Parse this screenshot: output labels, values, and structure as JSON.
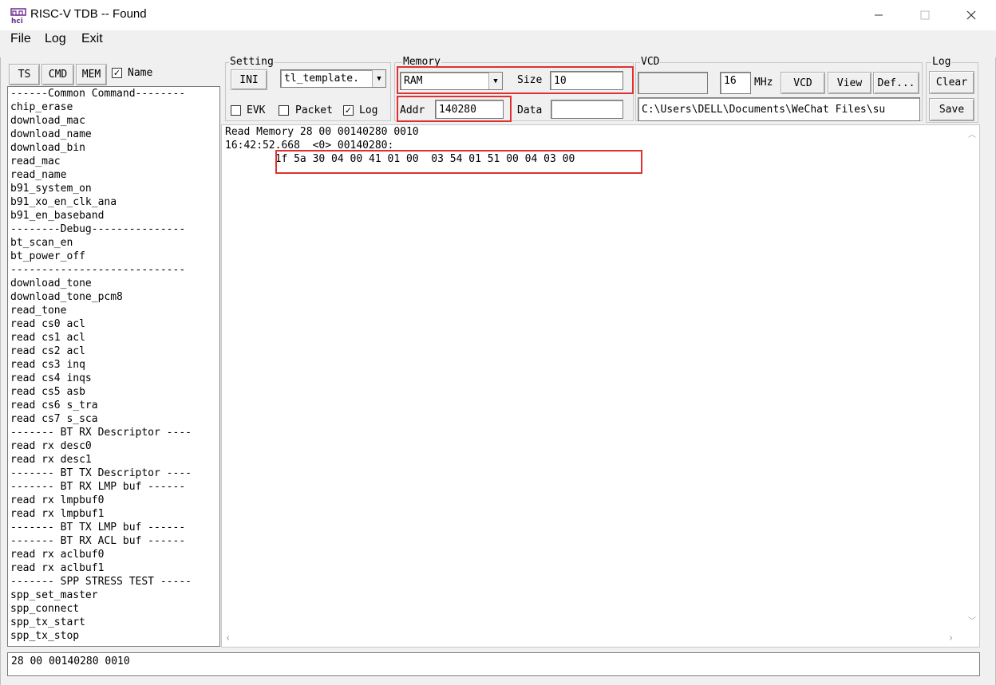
{
  "window": {
    "title": "RISC-V TDB -- Found",
    "app_icon_text": "hci",
    "minimize_icon": "minimize-icon",
    "maximize_icon": "maximize-icon",
    "close_icon": "close-icon"
  },
  "menu": {
    "items": [
      {
        "label": "File"
      },
      {
        "label": "Log"
      },
      {
        "label": "Exit"
      }
    ]
  },
  "left_tabs": {
    "ts": "TS",
    "cmd": "CMD",
    "mem": "MEM",
    "name_label": "Name",
    "name_checked": true
  },
  "commands": [
    "------Common Command--------",
    "chip_erase",
    "download_mac",
    "download_name",
    "download_bin",
    "read_mac",
    "read_name",
    "b91_system_on",
    "b91_xo_en_clk_ana",
    "b91_en_baseband",
    "--------Debug---------------",
    "bt_scan_en",
    "bt_power_off",
    "----------------------------",
    "download_tone",
    "download_tone_pcm8",
    "read_tone",
    "read cs0 acl",
    "read cs1 acl",
    "read cs2 acl",
    "read cs3 inq",
    "read cs4 inqs",
    "read cs5 asb",
    "read cs6 s_tra",
    "read cs7 s_sca",
    "------- BT RX Descriptor ----",
    "read rx desc0",
    "read rx desc1",
    "------- BT TX Descriptor ----",
    "------- BT RX LMP buf ------",
    "read rx lmpbuf0",
    "read rx lmpbuf1",
    "------- BT TX LMP buf ------",
    "------- BT RX ACL buf ------",
    "read rx aclbuf0",
    "read rx aclbuf1",
    "------- SPP STRESS TEST -----",
    "spp_set_master",
    "spp_connect",
    "spp_tx_start",
    "spp_tx_stop"
  ],
  "setting": {
    "title": "Setting",
    "ini_button": "INI",
    "template_value": "tl_template.",
    "evk_label": "EVK",
    "evk_checked": false,
    "packet_label": "Packet",
    "packet_checked": false,
    "log_label": "Log",
    "log_checked": true
  },
  "memory": {
    "title": "Memory",
    "type_value": "RAM",
    "size_label": "Size",
    "size_value": "10",
    "addr_label": "Addr",
    "addr_value": "140280",
    "data_label": "Data",
    "data_value": ""
  },
  "vcd": {
    "title": "VCD",
    "display_value": "",
    "freq_value": "16",
    "freq_unit": "MHz",
    "vcd_button": "VCD",
    "view_button": "View",
    "def_button": "Def...",
    "path_value": "C:\\Users\\DELL\\Documents\\WeChat Files\\su"
  },
  "log": {
    "title": "Log",
    "clear_button": "Clear",
    "save_button": "Save"
  },
  "output": {
    "lines": [
      "Read Memory 28 00 00140280 0010",
      "16:42:52.668  <0> 00140280:",
      "        1f 5a 30 04 00 41 01 00  03 54 01 51 00 04 03 00"
    ]
  },
  "command_input": {
    "value": "28 00 00140280 0010"
  },
  "colors": {
    "highlight_red": "#e03030",
    "chrome_gray": "#f0f0f0"
  }
}
